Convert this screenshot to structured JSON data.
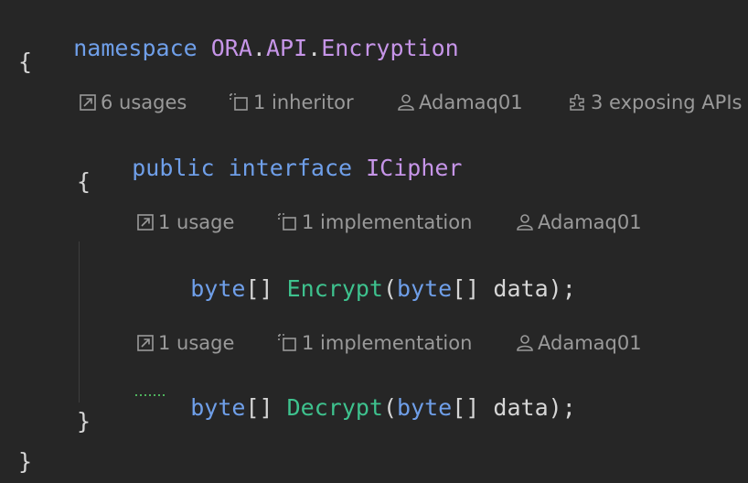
{
  "code": {
    "line1": {
      "kw": "namespace",
      "ns1": "ORA",
      "ns2": "API",
      "ns3": "Encryption",
      "dot": "."
    },
    "open_brace": "{",
    "close_brace": "}",
    "line_interface": {
      "kw1": "public",
      "kw2": "interface",
      "name": "ICipher"
    },
    "method_encrypt": {
      "type": "byte",
      "brackets": "[]",
      "name": "Encrypt",
      "open": "(",
      "param_type": "byte",
      "param_brackets": "[]",
      "param_name": "data",
      "close": ");"
    },
    "method_decrypt": {
      "type": "byte",
      "brackets": "[]",
      "name": "Decrypt",
      "open": "(",
      "param_type": "byte",
      "param_brackets": "[]",
      "param_name": "data",
      "close": ");"
    }
  },
  "lens_interface": {
    "usages": "6 usages",
    "inheritors": "1 inheritor",
    "author": "Adamaq01",
    "exposing": "3 exposing APIs"
  },
  "lens_encrypt": {
    "usages": "1 usage",
    "implementations": "1 implementation",
    "author": "Adamaq01"
  },
  "lens_decrypt": {
    "usages": "1 usage",
    "implementations": "1 implementation",
    "author": "Adamaq01"
  },
  "colors": {
    "background": "#262626",
    "keyword": "#6f9fe9",
    "namespace": "#c695e8",
    "method": "#3ec28e",
    "text": "#d6d6d6",
    "lens": "#9a9a9a"
  }
}
